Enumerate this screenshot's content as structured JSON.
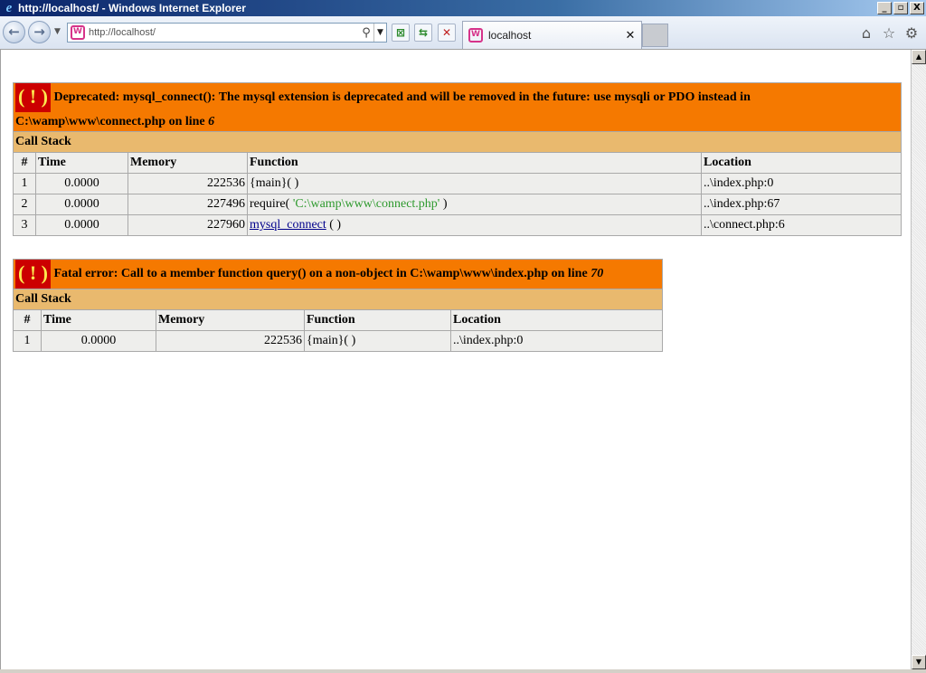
{
  "window": {
    "title": "http://localhost/ - Windows Internet Explorer",
    "controls": [
      "_",
      "▫",
      "X"
    ]
  },
  "toolbar": {
    "address": "http://localhost/",
    "tab_label": "localhost",
    "icons": [
      "back-icon",
      "forward-icon",
      "search-icon",
      "compat-view-icon",
      "refresh-icon",
      "stop-icon",
      "home-icon",
      "favorites-icon",
      "tools-icon"
    ]
  },
  "errors": [
    {
      "icon_text": "( ! )",
      "message": "Deprecated: mysql_connect(): The mysql extension is deprecated and will be removed in the future: use mysqli or PDO instead in C:\\wamp\\www\\connect.php on line ",
      "line": "6",
      "call_stack_label": "Call Stack",
      "headers": {
        "num": "#",
        "time": "Time",
        "memory": "Memory",
        "function": "Function",
        "location": "Location"
      },
      "rows": [
        {
          "num": "1",
          "time": "0.0000",
          "memory": "222536",
          "func_prefix": "{main}( )",
          "func_arg": "",
          "func_suffix": "",
          "location": "..\\index.php:0"
        },
        {
          "num": "2",
          "time": "0.0000",
          "memory": "227496",
          "func_prefix": "require( ",
          "func_arg": "'C:\\wamp\\www\\connect.php'",
          "func_suffix": " )",
          "location": "..\\index.php:67"
        },
        {
          "num": "3",
          "time": "0.0000",
          "memory": "227960",
          "func_link": "mysql_connect",
          "func_suffix": " ( )",
          "location": "..\\connect.php:6"
        }
      ]
    },
    {
      "icon_text": "( ! )",
      "message": "Fatal error: Call to a member function query() on a non-object in C:\\wamp\\www\\index.php on line ",
      "line": "70",
      "call_stack_label": "Call Stack",
      "headers": {
        "num": "#",
        "time": "Time",
        "memory": "Memory",
        "function": "Function",
        "location": "Location"
      },
      "rows": [
        {
          "num": "1",
          "time": "0.0000",
          "memory": "222536",
          "func_prefix": "{main}( )",
          "location": "..\\index.php:0"
        }
      ]
    }
  ],
  "colors": {
    "error_header": "#f57900",
    "error_icon_bg": "#cc0000",
    "error_icon_fg": "#fce94f",
    "call_stack_bg": "#e9b96e",
    "row_bg": "#eeeeec",
    "string_arg": "#2e9a2e",
    "link": "#00008b"
  }
}
